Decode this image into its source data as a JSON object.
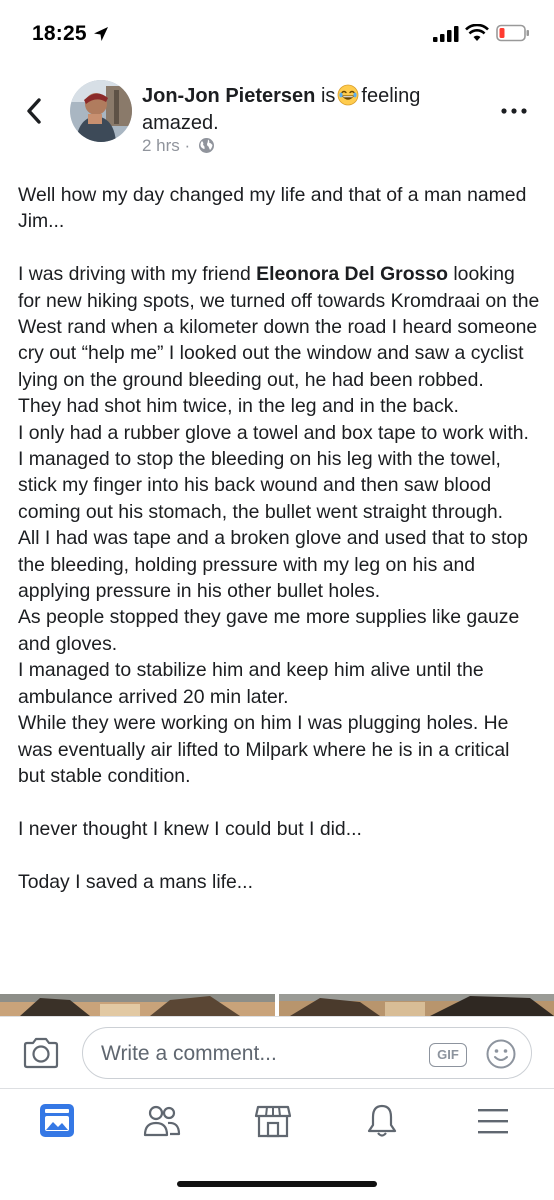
{
  "status_bar": {
    "time": "18:25"
  },
  "post": {
    "author": "Jon-Jon Pietersen",
    "activity_prefix": "is",
    "activity_emoji": "laughing-emoji",
    "activity_text": "feeling amazed.",
    "timestamp": "2 hrs",
    "separator": "·",
    "privacy_icon": "globe-icon",
    "paragraphs": [
      "Well how my day changed my life and that of a man named Jim...",
      "",
      "I was driving with my friend {tag} looking for new hiking spots, we turned off towards Kromdraai on the West rand when a kilometer down the road I heard someone cry out “help me” I looked out the window and saw a cyclist lying on the ground bleeding out, he had been robbed.",
      "They had shot him twice, in the leg and in the back.",
      "I only had a rubber glove a towel and box tape to work with.",
      "I managed to stop the bleeding on his leg with the towel, stick my finger into his back wound and then saw blood coming out his stomach, the bullet went straight through.",
      "All I had was tape and a broken glove and used that to stop the bleeding, holding pressure with my leg on his and applying pressure in his other bullet holes.",
      "As people stopped they gave me more supplies like gauze and gloves.",
      "I managed to stabilize him and keep him alive until the ambulance arrived 20 min later.",
      "While they were working on him I was plugging holes. He was eventually air lifted to Milpark where he is in a critical but stable condition.",
      "",
      "I never thought I knew I could but I did...",
      "",
      "Today I saved a mans life..."
    ],
    "tagged_friend": "Eleonora Del Grosso",
    "intro": "Well how my day changed my life and that of a man named Jim...",
    "p1_before": "I was driving with my friend ",
    "p1_after": " looking for new hiking spots, we turned off towards Kromdraai on the West rand when a kilometer down the road I heard someone cry out “help me” I looked out the window and saw a cyclist lying on the ground bleeding out, he had been robbed.",
    "p2": "They had shot him twice, in the leg and in the back.",
    "p3": "I only had a rubber glove a towel and box tape to work with.",
    "p4": "I managed to stop the bleeding on his leg with the towel, stick my finger into his back wound and then saw blood coming out his stomach, the bullet went straight through.",
    "p5": "All I had was tape and a broken glove and used that to stop the bleeding, holding pressure with my leg on his and applying pressure in his other bullet holes.",
    "p6": "As people stopped they gave me more supplies like gauze and gloves.",
    "p7": "I managed to stabilize him and keep him alive until the ambulance arrived 20 min later.",
    "p8": "While they were working on him I was plugging holes. He was eventually air lifted to Milpark where he is in a critical but stable condition.",
    "p9": "I never thought I knew I could but I did...",
    "p10": "Today I saved a mans life..."
  },
  "comment_bar": {
    "placeholder": "Write a comment...",
    "gif_label": "GIF",
    "camera_icon": "camera-icon",
    "sticker_icon": "smile-icon"
  },
  "bottom_nav": {
    "items": [
      {
        "icon": "news-feed-icon",
        "active": true
      },
      {
        "icon": "friends-icon",
        "active": false
      },
      {
        "icon": "marketplace-icon",
        "active": false
      },
      {
        "icon": "notifications-bell-icon",
        "active": false
      },
      {
        "icon": "menu-icon",
        "active": false
      }
    ]
  },
  "colors": {
    "accent": "#3578e5",
    "text": "#1c1e21",
    "secondary_text": "#90949c",
    "icon_gray": "#606770"
  }
}
